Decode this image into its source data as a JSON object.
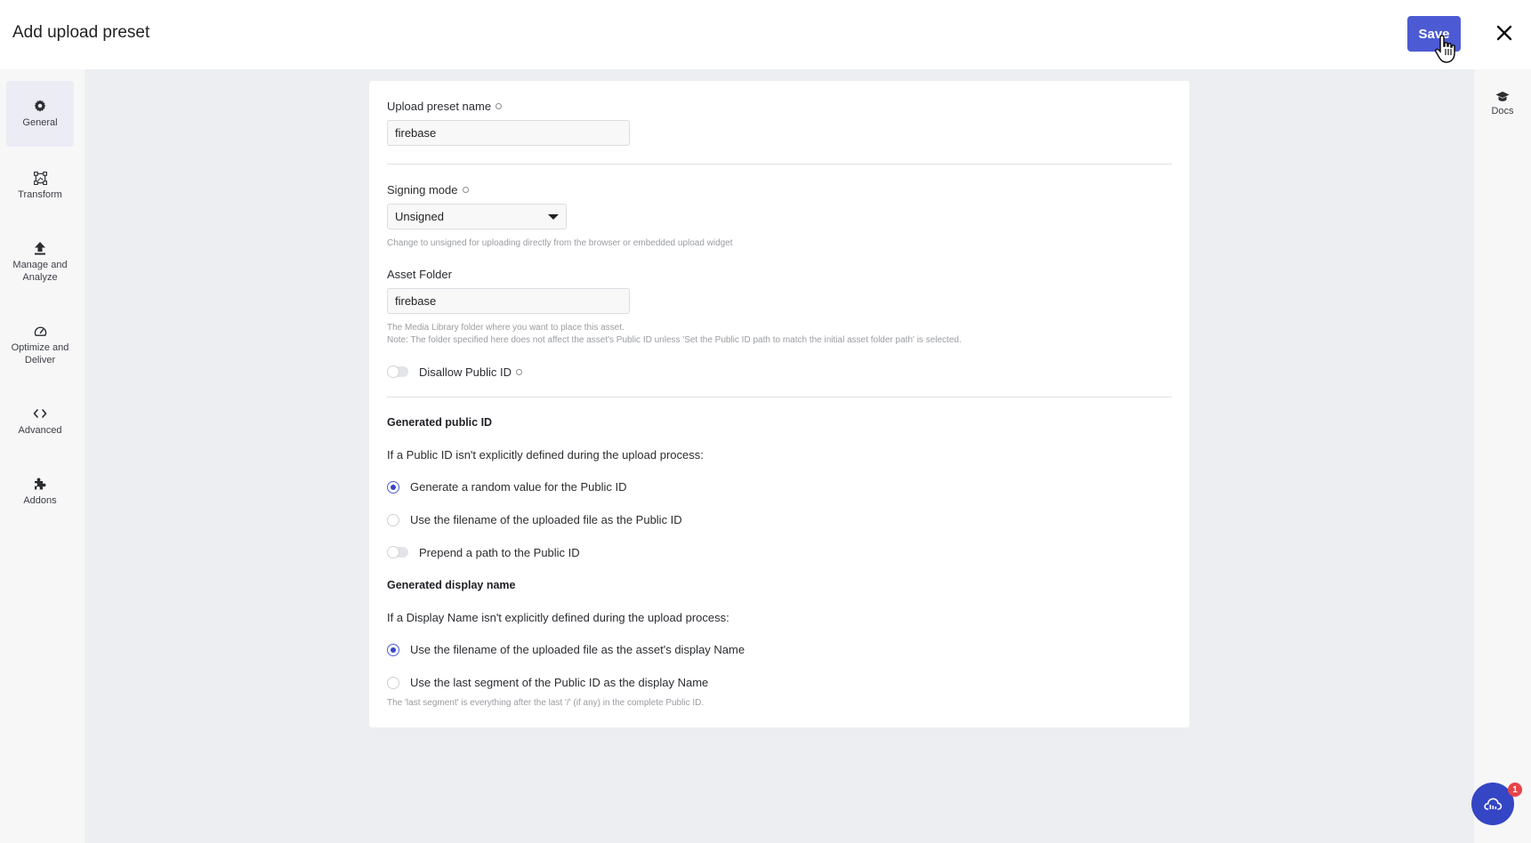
{
  "header": {
    "title": "Add upload preset",
    "save_label": "Save"
  },
  "left_nav": {
    "items": [
      {
        "label": "General",
        "icon": "gear-icon",
        "active": true
      },
      {
        "label": "Transform",
        "icon": "transform-icon",
        "active": false
      },
      {
        "label": "Manage and Analyze",
        "icon": "upload-icon",
        "active": false
      },
      {
        "label": "Optimize and Deliver",
        "icon": "gauge-icon",
        "active": false
      },
      {
        "label": "Advanced",
        "icon": "code-icon",
        "active": false
      },
      {
        "label": "Addons",
        "icon": "puzzle-icon",
        "active": false
      }
    ]
  },
  "right_nav": {
    "docs_label": "Docs"
  },
  "form": {
    "preset_name": {
      "label": "Upload preset name",
      "value": "firebase"
    },
    "signing_mode": {
      "label": "Signing mode",
      "value": "Unsigned",
      "help": "Change to unsigned for uploading directly from the browser or embedded upload widget"
    },
    "asset_folder": {
      "label": "Asset Folder",
      "value": "firebase",
      "help_line1": "The Media Library folder where you want to place this asset.",
      "help_line2": "Note: The folder specified here does not affect the asset's Public ID unless 'Set the Public ID path to match the initial asset folder path' is selected."
    },
    "disallow_public_id": {
      "label": "Disallow Public ID",
      "enabled": false
    },
    "generated_public_id": {
      "title": "Generated public ID",
      "intro": "If a Public ID isn't explicitly defined during the upload process:",
      "options": [
        {
          "label": "Generate a random value for the Public ID",
          "checked": true
        },
        {
          "label": "Use the filename of the uploaded file as the Public ID",
          "checked": false
        }
      ],
      "prepend_path": {
        "label": "Prepend a path to the Public ID",
        "enabled": false
      }
    },
    "generated_display_name": {
      "title": "Generated display name",
      "intro": "If a Display Name isn't explicitly defined during the upload process:",
      "options": [
        {
          "label": "Use the filename of the uploaded file as the asset's display Name",
          "checked": true
        },
        {
          "label": "Use the last segment of the Public ID as the display Name",
          "checked": false
        }
      ],
      "help": "The 'last segment' is everything after the last '/' (if any) in the complete Public ID."
    }
  },
  "support_widget": {
    "badge_count": "1"
  },
  "colors": {
    "accent": "#4c5bd4",
    "fab": "#3446c4",
    "badge": "#e8434a",
    "background": "#eceef1"
  }
}
